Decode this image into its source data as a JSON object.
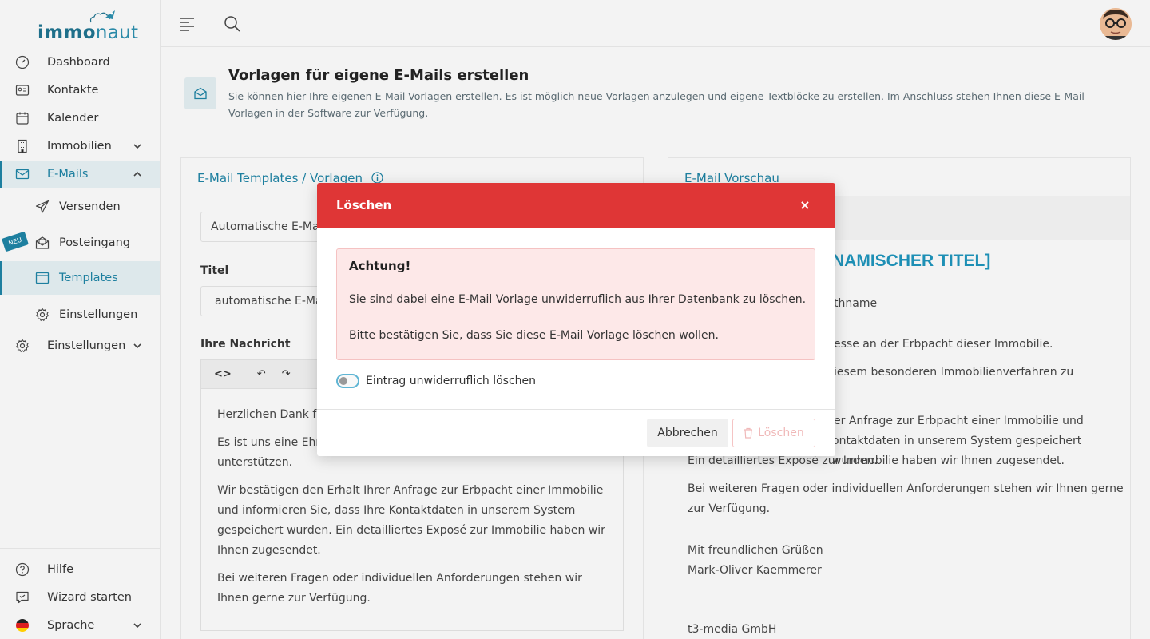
{
  "app": {
    "logo_main": "immo",
    "logo_accent": "naut"
  },
  "sidebar": {
    "items": [
      {
        "label": "Dashboard",
        "icon": "speedometer-icon"
      },
      {
        "label": "Kontakte",
        "icon": "contact-card-icon"
      },
      {
        "label": "Kalender",
        "icon": "calendar-icon"
      },
      {
        "label": "Immobilien",
        "icon": "building-icon"
      },
      {
        "label": "E-Mails",
        "icon": "envelope-icon"
      },
      {
        "label": "Versenden",
        "icon": "paper-plane-icon"
      },
      {
        "label": "Posteingang",
        "icon": "inbox-icon"
      },
      {
        "label": "Templates",
        "icon": "template-icon"
      },
      {
        "label": "Einstellungen",
        "icon": "gear-icon"
      },
      {
        "label": "Einstellungen",
        "icon": "gear-icon"
      }
    ],
    "neu_badge": "NEU",
    "bottom": [
      {
        "label": "Hilfe",
        "icon": "help-circle-icon"
      },
      {
        "label": "Wizard starten",
        "icon": "chat-icon"
      },
      {
        "label": "Sprache",
        "icon": "german-flag-icon"
      }
    ]
  },
  "page": {
    "title": "Vorlagen für eigene E-Mails erstellen",
    "description": "Sie können hier Ihre eigenen E-Mail-Vorlagen erstellen. Es ist möglich neue Vorlagen anzulegen und eigene Textblöcke zu erstellen. Im Anschluss stehen Ihnen diese E-Mail-Vorlagen in der Software zur Verfügung."
  },
  "left_card": {
    "title": "E-Mail Templates / Vorlagen",
    "select_value": "Automatische E-Mail",
    "title_label": "Titel",
    "title_value": "automatische E-Mai",
    "message_label": "Ihre Nachricht",
    "editor_paragraphs": [
      "Herzlichen Dank fü",
      "Es ist uns eine Ehre",
      "unterstützen.",
      "Wir bestätigen den Erhalt Ihrer Anfrage zur Erbpacht einer Immobilie und informieren Sie, dass Ihre Kontaktdaten in unserem System gespeichert wurden. Ein detailliertes Exposé zur Immobilie haben wir Ihnen zugesendet.",
      "Bei weiteren Fragen oder individuellen Anforderungen stehen wir Ihnen gerne zur Verfügung."
    ]
  },
  "right_card": {
    "title": "E-Mail Vorschau",
    "heading": "NAMISCHER TITEL]",
    "lines": [
      "thname",
      "esse an der Erbpacht dieser Immobilie.",
      "iesem besonderen Immobilienverfahren zu",
      "er Anfrage zur Erbpacht einer Immobilie und",
      "ontaktdaten in unserem System gespeichert wurden.",
      "Ein detailliertes Exposé zur Immobilie haben wir Ihnen zugesendet.",
      "Bei weiteren Fragen oder individuellen Anforderungen stehen wir Ihnen gerne",
      "zur Verfügung.",
      "Mit freundlichen Grüßen",
      "Mark-Oliver Kaemmerer",
      "t3-media GmbH"
    ]
  },
  "modal": {
    "title": "Löschen",
    "close": "×",
    "alert_title": "Achtung!",
    "alert_line1": "Sie sind dabei eine E-Mail Vorlage unwiderruflich aus Ihrer Datenbank zu löschen.",
    "alert_line2": "Bitte bestätigen Sie, dass Sie diese E-Mail Vorlage löschen wollen.",
    "toggle_label": "Eintrag unwiderruflich löschen",
    "toggle_on": false,
    "cancel": "Abbrechen",
    "delete": "Löschen"
  },
  "colors": {
    "accent": "#1d7f9f",
    "danger": "#df3636",
    "alert_bg": "#fde8e8"
  }
}
